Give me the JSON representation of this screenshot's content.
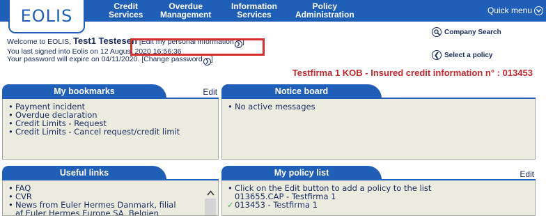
{
  "header": {
    "logo": "EOLIS",
    "nav": [
      {
        "line1": "Credit",
        "line2": "Services"
      },
      {
        "line1": "Overdue",
        "line2": "Management"
      },
      {
        "line1": "Information",
        "line2": "Services"
      },
      {
        "line1": "Policy",
        "line2": "Administration"
      }
    ],
    "quick_menu": "Quick menu",
    "colors": {
      "nav_bg": "#1f5fb8",
      "highlight": "#d42e2e",
      "policy_title": "#c1272d"
    }
  },
  "welcome": {
    "prefix": "Welcome to EOLIS,",
    "username": "Test1 Testesen",
    "edit_info": "[Edit my personal information",
    "edit_info_close": "]",
    "last_signed": "You last signed into Eolis on 12 August 2020 16:56:36",
    "password_expire": "Your password will expire on 04/11/2020.",
    "change_password": "[Change password",
    "change_password_close": "]"
  },
  "side_links": {
    "company_search": "Company Search",
    "select_policy": "Select a policy"
  },
  "policy_title": "Testfirma 1 KOB - Insured credit information n° : 013453",
  "panels": {
    "bookmarks": {
      "title": "My bookmarks",
      "edit": "Edit",
      "items": [
        "Payment incident",
        "Overdue declaration",
        "Credit Limits - Request",
        "Credit Limits - Cancel request/credit limit"
      ]
    },
    "notice": {
      "title": "Notice board",
      "items": [
        "No active messages"
      ]
    },
    "useful": {
      "title": "Useful links",
      "items": [
        "FAQ",
        "CVR",
        "News from Euler Hermes Danmark, filial",
        "af Euler Hermes Europe SA, Belgien"
      ]
    },
    "policy": {
      "title": "My policy list",
      "edit": "Edit",
      "items": [
        "Click on the Edit button to add a policy to the list",
        "013655.CAP - Testfirma 1",
        "013453 - Testfirma 1"
      ]
    }
  }
}
